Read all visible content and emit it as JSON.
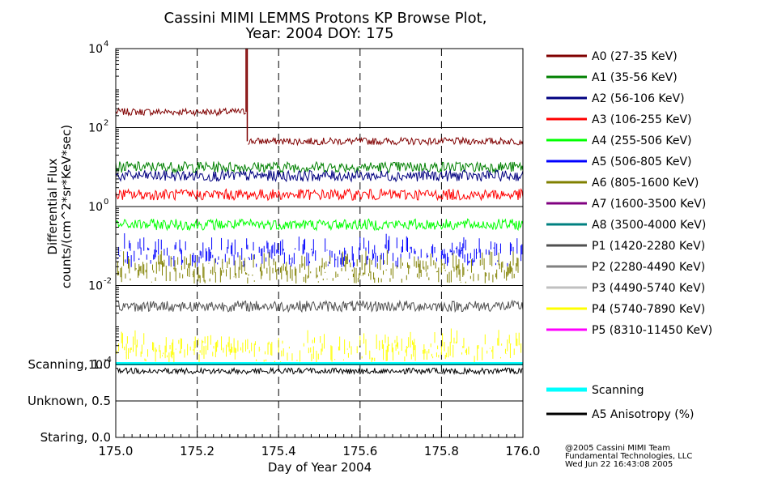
{
  "chart_data": {
    "type": "line",
    "title_line1": "Cassini MIMI LEMMS Protons KP Browse Plot,",
    "title_line2": "Year: 2004 DOY: 175",
    "xlabel": "Day of Year 2004",
    "ylabel_line1": "Differential Flux",
    "ylabel_line2": "counts/(cm^2*sr*KeV*sec)",
    "xlim": [
      175.0,
      176.0
    ],
    "x_ticks": [
      "175.0",
      "175.2",
      "175.4",
      "175.6",
      "175.8",
      "176.0"
    ],
    "ylim": [
      0.0001,
      10000
    ],
    "y_scale": "log",
    "y_ticks": [
      {
        "value": 10000,
        "base": "10",
        "exp": "4"
      },
      {
        "value": 100,
        "base": "10",
        "exp": "2"
      },
      {
        "value": 1,
        "base": "10",
        "exp": "0"
      },
      {
        "value": 0.01,
        "base": "10",
        "exp": "-2"
      },
      {
        "value": 0.0001,
        "base": "10",
        "exp": "-4"
      }
    ],
    "grid": "dashed vertical at 175.2, 175.4, 175.6, 175.8",
    "legend_placement": "right",
    "series": [
      {
        "name": "A0 (27-35 KeV)",
        "color": "#800000",
        "segments": [
          {
            "x0": 175.0,
            "x1": 175.32,
            "level": 250
          },
          {
            "x0": 175.325,
            "x1": 176.0,
            "level": 45
          }
        ],
        "spike": {
          "x": 175.32,
          "peak": 10000
        }
      },
      {
        "name": "A1 (35-56 KeV)",
        "color": "#008000",
        "level": 10
      },
      {
        "name": "A2 (56-106 KeV)",
        "color": "#000080",
        "level": 6
      },
      {
        "name": "A3 (106-255 KeV)",
        "color": "#ff0000",
        "level": 2
      },
      {
        "name": "A4 (255-506 KeV)",
        "color": "#00ff00",
        "level": 0.35
      },
      {
        "name": "A5 (506-805 KeV)",
        "color": "#0000ff",
        "level": 0.05,
        "sparse": true
      },
      {
        "name": "A6 (805-1600 KeV)",
        "color": "#808000",
        "level": 0.02,
        "sparse": true
      },
      {
        "name": "A7 (1600-3500 KeV)",
        "color": "#800080"
      },
      {
        "name": "A8 (3500-4000 KeV)",
        "color": "#008080"
      },
      {
        "name": "P1 (1420-2280 KeV)",
        "color": "#505050",
        "level": 0.003
      },
      {
        "name": "P2 (2280-4490 KeV)",
        "color": "#808080"
      },
      {
        "name": "P3 (4490-5740 KeV)",
        "color": "#c0c0c0"
      },
      {
        "name": "P4 (5740-7890 KeV)",
        "color": "#ffff00",
        "level": 0.0002,
        "sparse": true
      },
      {
        "name": "P5 (8310-11450 KeV)",
        "color": "#ff00ff"
      }
    ],
    "lower_panel": {
      "y_ticks": [
        {
          "label": "Scanning, 1.0",
          "value": 1.0
        },
        {
          "label": "Unknown, 0.5",
          "value": 0.5
        },
        {
          "label": "Staring, 0.0",
          "value": 0.0
        }
      ],
      "series": [
        {
          "name": "Scanning",
          "color": "#00ffff",
          "value": 1.0
        },
        {
          "name": "A5 Anisotropy (%)",
          "color": "#000000",
          "value": 0.95
        }
      ]
    }
  },
  "footer": {
    "line1": "@2005 Cassini MIMI Team",
    "line2": "Fundamental Technologies, LLC",
    "line3": "Wed Jun 22 16:43:08 2005"
  }
}
